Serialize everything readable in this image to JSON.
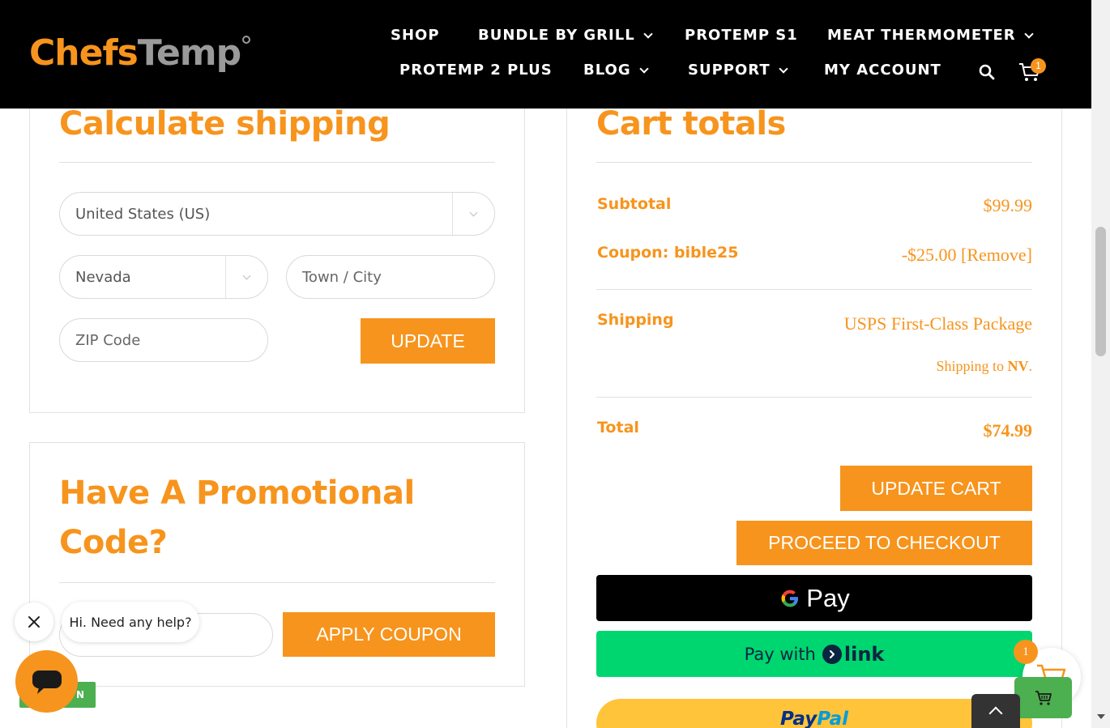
{
  "header": {
    "logo": {
      "part1": "Chefs",
      "part2": "Temp"
    },
    "nav_row1": [
      "SHOP",
      "BUNDLE BY GRILL",
      "PROTEMP S1",
      "MEAT THERMOMETER"
    ],
    "nav_row2": [
      "PROTEMP 2 PLUS",
      "BLOG",
      "SUPPORT",
      "MY ACCOUNT"
    ],
    "cart_count": "1"
  },
  "shipping_calc": {
    "heading": "Calculate shipping",
    "country": "United States (US)",
    "state": "Nevada",
    "city_placeholder": "Town / City",
    "zip_placeholder": "ZIP Code",
    "update_label": "UPDATE"
  },
  "promo": {
    "heading_line1": "Have A Promotional",
    "heading_line2": "Code?",
    "coupon_placeholder": "",
    "apply_label": "APPLY COUPON"
  },
  "cart_totals": {
    "heading": "Cart totals",
    "subtotal_label": "Subtotal",
    "subtotal_value": "$99.99",
    "coupon_label": "Coupon: bible25",
    "coupon_value": "-$25.00",
    "coupon_remove": "[Remove]",
    "shipping_label": "Shipping",
    "shipping_method": "USPS First-Class Package",
    "shipping_to_prefix": "Shipping to ",
    "shipping_to_state": "NV",
    "shipping_to_suffix": ".",
    "total_label": "Total",
    "total_value": "$74.99",
    "update_cart_label": "UPDATE CART",
    "checkout_label": "PROCEED TO CHECKOUT",
    "gpay_label": "Pay",
    "link_pay_label": "Pay with",
    "link_label": "link",
    "paypal_part1": "Pay",
    "paypal_part2": "Pal"
  },
  "chat": {
    "greeting": "Hi. Need any help?",
    "tag_text": "N"
  },
  "floating_cart": {
    "count": "1"
  },
  "colors": {
    "accent": "#f7941d",
    "header_bg": "#000000",
    "gpay_bg": "#000000",
    "link_bg": "#00d66f",
    "paypal_bg": "#ffc439",
    "green": "#4caf50"
  }
}
